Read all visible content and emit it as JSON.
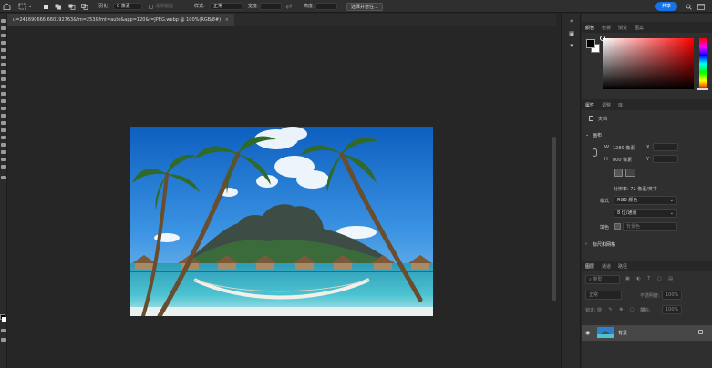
{
  "options_bar": {
    "feather_label": "羽化:",
    "feather_value": "0 像素",
    "antialias_label": "消除锯齿",
    "style_label": "样式:",
    "style_value": "正常",
    "width_label": "宽度:",
    "height_label": "高度:",
    "select_subject_button": "选择并遮住...",
    "share_button": "共享"
  },
  "document": {
    "tab_title": "u=241690666,660192763&fm=253&fmt=auto&app=120&f=JPEG.webp @ 100%(RGB/8#)"
  },
  "color_panel": {
    "tabs": [
      "颜色",
      "色板",
      "渐变",
      "图案"
    ],
    "foreground": "#000000",
    "background": "#ffffff",
    "hue": "#ff0000"
  },
  "properties_panel": {
    "tabs": [
      "属性",
      "调整",
      "库"
    ],
    "doc_label": "文档",
    "canvas_section": "画布",
    "w_label": "W",
    "w_value": "1280 像素",
    "x_label": "X",
    "h_label": "H",
    "h_value": "800 像素",
    "y_label": "Y",
    "resolution": "分辨率: 72 像素/英寸",
    "mode_label": "模式",
    "mode_value": "RGB 颜色",
    "depth_value": "8 位/通道",
    "fill_label": "填色",
    "fill_value": "背景色",
    "rulers_section": "标尺和网格"
  },
  "layers_panel": {
    "tabs": [
      "图层",
      "通道",
      "路径"
    ],
    "kind_label": "类型",
    "blend_value": "正常",
    "opacity_label": "不透明度:",
    "opacity_value": "100%",
    "lock_label": "锁定:",
    "fill_label": "填充:",
    "fill_value": "100%",
    "layer_name": "背景"
  }
}
